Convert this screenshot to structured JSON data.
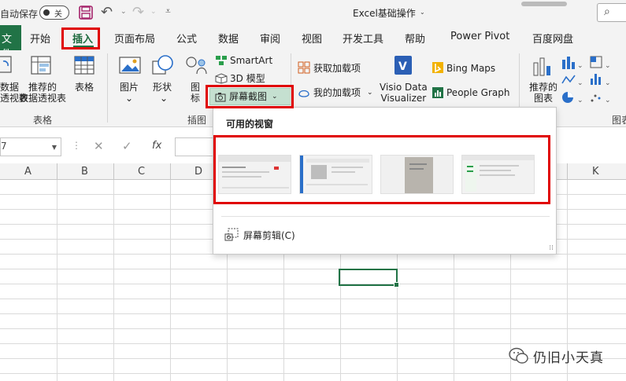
{
  "titlebar": {
    "autosave_label": "自动保存",
    "autosave_state": "关",
    "doc_title": "Excel基础操作",
    "doc_title_dropdown": "⌄",
    "undo_glyph": "↶",
    "redo_glyph": "↷",
    "dropdown_glyph": "⌄",
    "customize_glyph": "⩡",
    "search_glyph": "⌕"
  },
  "tabs": {
    "file": "文件",
    "items": [
      "开始",
      "插入",
      "页面布局",
      "公式",
      "数据",
      "审阅",
      "视图",
      "开发工具",
      "帮助",
      "Power Pivot",
      "百度网盘"
    ],
    "active": "插入"
  },
  "ribbon": {
    "tables": {
      "pivot_table": "数据\n透视表",
      "recommended_pivot": "推荐的\n数据透视表",
      "table": "表格",
      "group_label": "表格"
    },
    "illustrations": {
      "pictures": "图片",
      "shapes": "形状",
      "icons": "图\n标",
      "smartart": "SmartArt",
      "3d_models": "3D 模型",
      "screenshot": "屏幕截图",
      "group_label": "插图"
    },
    "addins": {
      "get_addins": "获取加载项",
      "my_addins": "我的加载项",
      "visio": "Visio Data\nVisualizer",
      "bing_maps": "Bing Maps",
      "people_graph": "People Graph"
    },
    "charts": {
      "recommended_charts": "推荐的\n图表",
      "group_label": "图表"
    }
  },
  "formula_bar": {
    "name_box": "7",
    "cancel_glyph": "✕",
    "enter_glyph": "✓",
    "fx_label": "fx",
    "dots": "⋮"
  },
  "grid": {
    "columns": [
      "A",
      "B",
      "C",
      "D",
      "K"
    ]
  },
  "screenshot_dropdown": {
    "title": "可用的视窗",
    "thumbnail_count": 4,
    "screen_clipping_label": "屏幕剪辑(C)"
  },
  "watermark": {
    "text": "仍旧小天真"
  },
  "colors": {
    "excel_green": "#217346",
    "highlight_red": "#e00000",
    "ribbon_bg": "#f3f3f3"
  }
}
